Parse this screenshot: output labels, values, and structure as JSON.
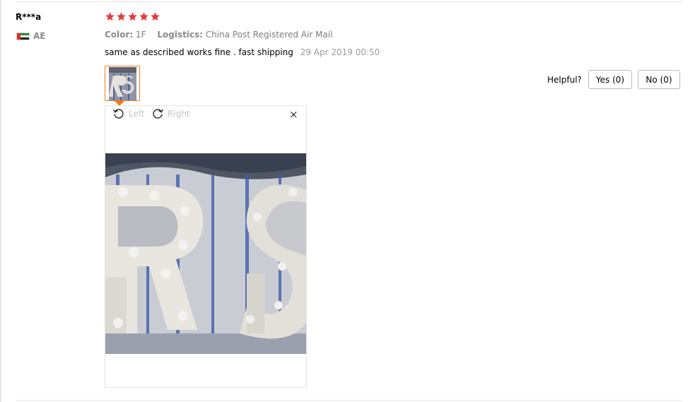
{
  "review": {
    "user": {
      "name": "R***a",
      "country_code": "AE"
    },
    "rating": {
      "stars": 5,
      "max": 5,
      "color": "#e83a3a"
    },
    "attributes": [
      {
        "key": "Color:",
        "value": "1F"
      },
      {
        "key": "Logistics:",
        "value": "China Post Registered Air Mail"
      }
    ],
    "text": "same as described works fine . fast shipping",
    "date": "29 Apr 2019 00:50"
  },
  "helpful": {
    "label": "Helpful?",
    "yes_label": "Yes (0)",
    "no_label": "No (0)"
  },
  "viewer": {
    "rotate_left": "Left",
    "rotate_right": "Right",
    "close": "×"
  },
  "colors": {
    "accent": "#f27a1a",
    "star": "#e83a3a"
  }
}
